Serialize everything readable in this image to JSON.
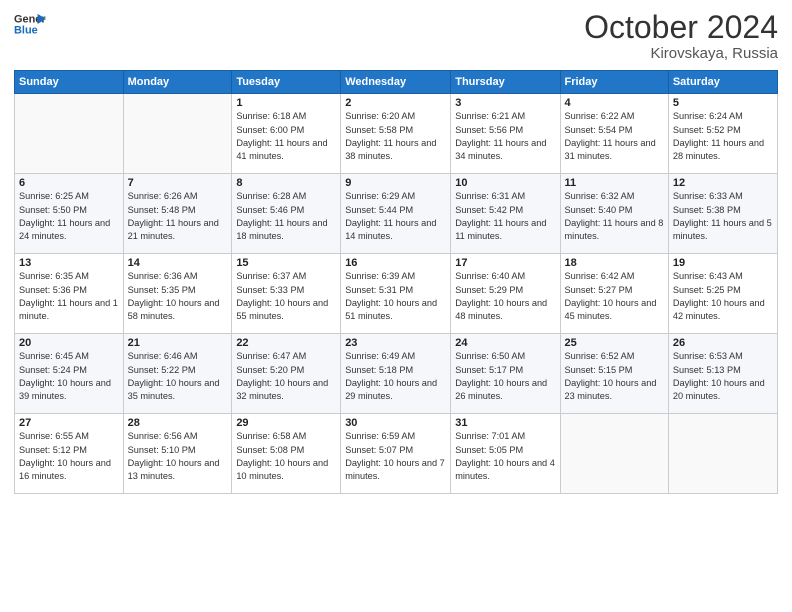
{
  "header": {
    "logo_line1": "General",
    "logo_line2": "Blue",
    "month": "October 2024",
    "location": "Kirovskaya, Russia"
  },
  "weekdays": [
    "Sunday",
    "Monday",
    "Tuesday",
    "Wednesday",
    "Thursday",
    "Friday",
    "Saturday"
  ],
  "weeks": [
    [
      {
        "day": "",
        "info": ""
      },
      {
        "day": "",
        "info": ""
      },
      {
        "day": "1",
        "info": "Sunrise: 6:18 AM\nSunset: 6:00 PM\nDaylight: 11 hours and 41 minutes."
      },
      {
        "day": "2",
        "info": "Sunrise: 6:20 AM\nSunset: 5:58 PM\nDaylight: 11 hours and 38 minutes."
      },
      {
        "day": "3",
        "info": "Sunrise: 6:21 AM\nSunset: 5:56 PM\nDaylight: 11 hours and 34 minutes."
      },
      {
        "day": "4",
        "info": "Sunrise: 6:22 AM\nSunset: 5:54 PM\nDaylight: 11 hours and 31 minutes."
      },
      {
        "day": "5",
        "info": "Sunrise: 6:24 AM\nSunset: 5:52 PM\nDaylight: 11 hours and 28 minutes."
      }
    ],
    [
      {
        "day": "6",
        "info": "Sunrise: 6:25 AM\nSunset: 5:50 PM\nDaylight: 11 hours and 24 minutes."
      },
      {
        "day": "7",
        "info": "Sunrise: 6:26 AM\nSunset: 5:48 PM\nDaylight: 11 hours and 21 minutes."
      },
      {
        "day": "8",
        "info": "Sunrise: 6:28 AM\nSunset: 5:46 PM\nDaylight: 11 hours and 18 minutes."
      },
      {
        "day": "9",
        "info": "Sunrise: 6:29 AM\nSunset: 5:44 PM\nDaylight: 11 hours and 14 minutes."
      },
      {
        "day": "10",
        "info": "Sunrise: 6:31 AM\nSunset: 5:42 PM\nDaylight: 11 hours and 11 minutes."
      },
      {
        "day": "11",
        "info": "Sunrise: 6:32 AM\nSunset: 5:40 PM\nDaylight: 11 hours and 8 minutes."
      },
      {
        "day": "12",
        "info": "Sunrise: 6:33 AM\nSunset: 5:38 PM\nDaylight: 11 hours and 5 minutes."
      }
    ],
    [
      {
        "day": "13",
        "info": "Sunrise: 6:35 AM\nSunset: 5:36 PM\nDaylight: 11 hours and 1 minute."
      },
      {
        "day": "14",
        "info": "Sunrise: 6:36 AM\nSunset: 5:35 PM\nDaylight: 10 hours and 58 minutes."
      },
      {
        "day": "15",
        "info": "Sunrise: 6:37 AM\nSunset: 5:33 PM\nDaylight: 10 hours and 55 minutes."
      },
      {
        "day": "16",
        "info": "Sunrise: 6:39 AM\nSunset: 5:31 PM\nDaylight: 10 hours and 51 minutes."
      },
      {
        "day": "17",
        "info": "Sunrise: 6:40 AM\nSunset: 5:29 PM\nDaylight: 10 hours and 48 minutes."
      },
      {
        "day": "18",
        "info": "Sunrise: 6:42 AM\nSunset: 5:27 PM\nDaylight: 10 hours and 45 minutes."
      },
      {
        "day": "19",
        "info": "Sunrise: 6:43 AM\nSunset: 5:25 PM\nDaylight: 10 hours and 42 minutes."
      }
    ],
    [
      {
        "day": "20",
        "info": "Sunrise: 6:45 AM\nSunset: 5:24 PM\nDaylight: 10 hours and 39 minutes."
      },
      {
        "day": "21",
        "info": "Sunrise: 6:46 AM\nSunset: 5:22 PM\nDaylight: 10 hours and 35 minutes."
      },
      {
        "day": "22",
        "info": "Sunrise: 6:47 AM\nSunset: 5:20 PM\nDaylight: 10 hours and 32 minutes."
      },
      {
        "day": "23",
        "info": "Sunrise: 6:49 AM\nSunset: 5:18 PM\nDaylight: 10 hours and 29 minutes."
      },
      {
        "day": "24",
        "info": "Sunrise: 6:50 AM\nSunset: 5:17 PM\nDaylight: 10 hours and 26 minutes."
      },
      {
        "day": "25",
        "info": "Sunrise: 6:52 AM\nSunset: 5:15 PM\nDaylight: 10 hours and 23 minutes."
      },
      {
        "day": "26",
        "info": "Sunrise: 6:53 AM\nSunset: 5:13 PM\nDaylight: 10 hours and 20 minutes."
      }
    ],
    [
      {
        "day": "27",
        "info": "Sunrise: 6:55 AM\nSunset: 5:12 PM\nDaylight: 10 hours and 16 minutes."
      },
      {
        "day": "28",
        "info": "Sunrise: 6:56 AM\nSunset: 5:10 PM\nDaylight: 10 hours and 13 minutes."
      },
      {
        "day": "29",
        "info": "Sunrise: 6:58 AM\nSunset: 5:08 PM\nDaylight: 10 hours and 10 minutes."
      },
      {
        "day": "30",
        "info": "Sunrise: 6:59 AM\nSunset: 5:07 PM\nDaylight: 10 hours and 7 minutes."
      },
      {
        "day": "31",
        "info": "Sunrise: 7:01 AM\nSunset: 5:05 PM\nDaylight: 10 hours and 4 minutes."
      },
      {
        "day": "",
        "info": ""
      },
      {
        "day": "",
        "info": ""
      }
    ]
  ]
}
